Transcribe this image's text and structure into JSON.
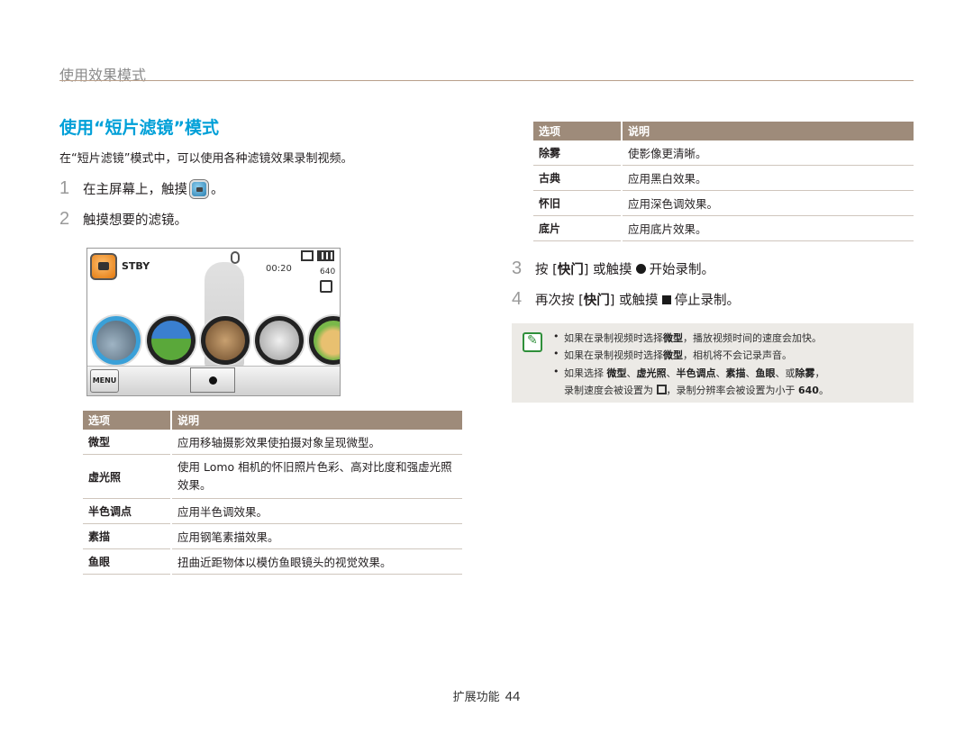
{
  "header": {
    "section": "使用效果模式"
  },
  "heading": "使用“短片滤镜”模式",
  "intro": "在“短片滤镜”模式中，可以使用各种滤镜效果录制视频。",
  "steps": [
    {
      "num": "1",
      "pre": "在主屏幕上，触摸",
      "post": "。"
    },
    {
      "num": "2",
      "text": "触摸想要的滤镜。"
    },
    {
      "num": "3",
      "pre": "按 [",
      "key": "快门",
      "mid": "] 或触摸",
      "post": "开始录制。"
    },
    {
      "num": "4",
      "pre": "再次按 [",
      "key": "快门",
      "mid": "] 或触摸",
      "post": "停止录制。"
    }
  ],
  "camera_screen": {
    "status": "STBY",
    "time": "00:20",
    "resolution": "640",
    "menu_label": "MENU",
    "icons": [
      "movie-mode-icon",
      "mic-off-icon",
      "memory-card-icon",
      "battery-icon",
      "quality-icon",
      "record-icon"
    ]
  },
  "table_left": {
    "headers": [
      "选项",
      "说明"
    ],
    "rows": [
      {
        "name": "微型",
        "desc": "应用移轴摄影效果使拍摄对象呈现微型。"
      },
      {
        "name": "虚光照",
        "desc": "使用 Lomo 相机的怀旧照片色彩、高对比度和强虚光照效果。"
      },
      {
        "name": "半色调点",
        "desc": "应用半色调效果。"
      },
      {
        "name": "素描",
        "desc": "应用钢笔素描效果。"
      },
      {
        "name": "鱼眼",
        "desc": "扭曲近距物体以模仿鱼眼镜头的视觉效果。"
      }
    ]
  },
  "table_right": {
    "headers": [
      "选项",
      "说明"
    ],
    "rows": [
      {
        "name": "除雾",
        "desc": "使影像更清晰。"
      },
      {
        "name": "古典",
        "desc": "应用黑白效果。"
      },
      {
        "name": "怀旧",
        "desc": "应用深色调效果。"
      },
      {
        "name": "底片",
        "desc": "应用底片效果。"
      }
    ]
  },
  "notes": {
    "n1_pre": "如果在录制视频时选择",
    "n1_bold": "微型",
    "n1_post": "，播放视频时间的速度会加快。",
    "n2_pre": "如果在录制视频时选择",
    "n2_bold": "微型",
    "n2_post": "，相机将不会记录声音。",
    "n3_pre": "如果选择",
    "n3_b1": "微型",
    "n3_b2": "虚光照",
    "n3_b3": "半色调点",
    "n3_b4": "素描",
    "n3_b5": "鱼眼",
    "n3_or": "或",
    "n3_b6": "除雾",
    "n3_l2_pre": "录制速度会被设置为",
    "n3_l2_mid": "，录制分辨率会被设置为小于",
    "n3_l2_val": "640",
    "n3_l2_end": "。"
  },
  "footer": {
    "label": "扩展功能",
    "page": "44"
  }
}
